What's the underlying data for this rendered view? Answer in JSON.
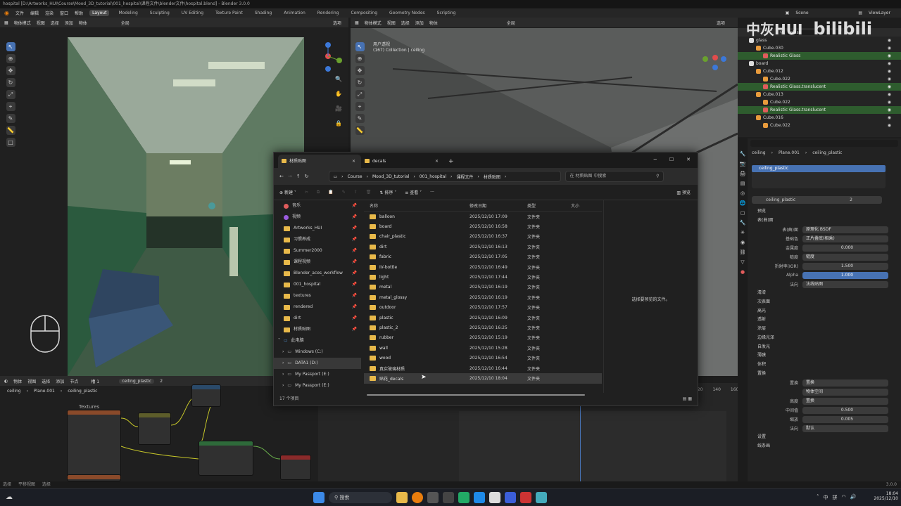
{
  "app": {
    "title": "hospital [D:\\Artworks_HUI\\Course\\Mood_3D_tutorial\\001_hospital\\课程文件\\blender文件\\hospital.blend] - Blender 3.0.0",
    "menu": [
      "文件",
      "编辑",
      "渲染",
      "窗口",
      "帮助"
    ],
    "workspaces": [
      "Layout",
      "Modeling",
      "Sculpting",
      "UV Editing",
      "Texture Paint",
      "Shading",
      "Animation",
      "Rendering",
      "Compositing",
      "Geometry Nodes",
      "Scripting"
    ],
    "active_workspace": "Layout",
    "scene": "Scene",
    "view_layer": "ViewLayer"
  },
  "viewport_left": {
    "header": [
      "物体模式",
      "视图",
      "选择",
      "添加",
      "物体"
    ],
    "shading": "全局",
    "options": "选项"
  },
  "viewport_right": {
    "header": [
      "物体模式",
      "视图",
      "选择",
      "添加",
      "物体"
    ],
    "shading": "全局",
    "options": "选项",
    "view_name": "用户透视",
    "collection": "(167) Collection | ceiling"
  },
  "watermark": {
    "text": "中灰HUI",
    "logo": "bilibili"
  },
  "outliner": {
    "search": "glass",
    "rows": [
      {
        "indent": 1,
        "label": "glass",
        "type": "collection"
      },
      {
        "indent": 2,
        "label": "Cube.030",
        "type": "mesh"
      },
      {
        "indent": 3,
        "label": "Realistic Glass",
        "type": "material"
      },
      {
        "indent": 1,
        "label": "board",
        "type": "collection"
      },
      {
        "indent": 2,
        "label": "Cube.012",
        "type": "mesh"
      },
      {
        "indent": 3,
        "label": "Cube.022",
        "type": "mesh"
      },
      {
        "indent": 3,
        "label": "Realistic Glass.translucent",
        "type": "material"
      },
      {
        "indent": 2,
        "label": "Cube.013",
        "type": "mesh"
      },
      {
        "indent": 3,
        "label": "Cube.022",
        "type": "mesh"
      },
      {
        "indent": 3,
        "label": "Realistic Glass.translucent",
        "type": "material"
      },
      {
        "indent": 2,
        "label": "Cube.016",
        "type": "mesh"
      },
      {
        "indent": 3,
        "label": "Cube.022",
        "type": "mesh"
      }
    ]
  },
  "properties": {
    "breadcrumb": [
      "ceiling",
      "Plane.001",
      "ceiling_plastic"
    ],
    "slot": "ceiling_plastic",
    "material_name": "ceiling_plastic",
    "users": "2",
    "section_preview": "预览",
    "section_surface": "表(曲)面",
    "rows": [
      {
        "label": "表(曲)面",
        "value": "原理化 BSDF",
        "style": "normal"
      },
      {
        "label": "基础色",
        "value": "正片叠底(相乘)",
        "style": "normal"
      },
      {
        "label": "金属度",
        "value": "0.000",
        "style": "center"
      },
      {
        "label": "糙度",
        "value": "糙度",
        "style": "normal"
      },
      {
        "label": "折射率(IOR)",
        "value": "1.500",
        "style": "center"
      },
      {
        "label": "Alpha",
        "value": "1.000",
        "style": "blue"
      },
      {
        "label": "法向",
        "value": "法线贴图",
        "style": "normal"
      }
    ],
    "subsections": [
      "清漆",
      "次表面",
      "高光",
      "透射",
      "涂层",
      "边缘光泽",
      "自发光",
      "薄膜"
    ],
    "volume": "体积",
    "displacement": "置换",
    "disp_rows": [
      {
        "label": "置换",
        "value": "置换",
        "style": "normal"
      },
      {
        "label": "",
        "value": "物体空间",
        "style": "normal"
      },
      {
        "label": "高度",
        "value": "置换",
        "style": "normal"
      },
      {
        "label": "中间值",
        "value": "0.500",
        "style": "center"
      },
      {
        "label": "缩放",
        "value": "0.005",
        "style": "center"
      },
      {
        "label": "法向",
        "value": "默认",
        "style": "normal"
      }
    ],
    "settings": "设置",
    "line_art": "线条画"
  },
  "node_editor": {
    "header": [
      "物体",
      "视图",
      "选择",
      "添加",
      "节点"
    ],
    "slot": "槽 1",
    "material": "ceiling_plastic",
    "users": "2",
    "breadcrumb": [
      "ceiling",
      "Plane.001",
      "ceiling_plastic"
    ],
    "frame_label": "Textures"
  },
  "timeline": {
    "frames": [
      "120",
      "140",
      "160"
    ]
  },
  "statusbar": {
    "left": [
      "选择",
      "平移视图",
      "选择"
    ],
    "version": "3.0.0"
  },
  "explorer": {
    "tabs": [
      {
        "label": "材质贴图"
      },
      {
        "label": "decals"
      }
    ],
    "breadcrumbs": [
      "Course",
      "Mood_3D_tutorial",
      "001_hospital",
      "课程文件",
      "材质贴图"
    ],
    "search_placeholder": "在 材质贴图 中搜索",
    "new_label": "新建",
    "sort_label": "排序",
    "view_label": "查看",
    "preview_label": "预览",
    "nav_items": [
      {
        "label": "音乐",
        "icon": "music",
        "pinned": true
      },
      {
        "label": "视频",
        "icon": "video",
        "pinned": true
      },
      {
        "label": "Artworks_HUI",
        "icon": "folder",
        "pinned": true
      },
      {
        "label": "习惯养成",
        "icon": "folder",
        "pinned": true
      },
      {
        "label": "Summer2000",
        "icon": "folder",
        "pinned": true
      },
      {
        "label": "课程视频",
        "icon": "folder",
        "pinned": true
      },
      {
        "label": "Blender_aces_workflow",
        "icon": "folder",
        "pinned": true
      },
      {
        "label": "001_hospital",
        "icon": "folder",
        "pinned": true
      },
      {
        "label": "textures",
        "icon": "folder",
        "pinned": true
      },
      {
        "label": "rendered",
        "icon": "folder",
        "pinned": true
      },
      {
        "label": "dirt",
        "icon": "folder",
        "pinned": true
      },
      {
        "label": "材质贴图",
        "icon": "folder",
        "pinned": true
      }
    ],
    "this_pc": "此电脑",
    "drives": [
      {
        "label": "Windows (C:)",
        "selected": false
      },
      {
        "label": "DATA1 (D:)",
        "selected": true
      },
      {
        "label": "My Passport (E:)",
        "selected": false
      },
      {
        "label": "My Passport (E:)",
        "selected": false
      }
    ],
    "columns": [
      "名称",
      "修改日期",
      "类型",
      "大小"
    ],
    "files": [
      {
        "name": "balloon",
        "date": "2025/12/10 17:09",
        "type": "文件夹"
      },
      {
        "name": "board",
        "date": "2025/12/10 16:58",
        "type": "文件夹"
      },
      {
        "name": "chair_plastic",
        "date": "2025/12/10 16:37",
        "type": "文件夹"
      },
      {
        "name": "dirt",
        "date": "2025/12/10 16:13",
        "type": "文件夹"
      },
      {
        "name": "fabric",
        "date": "2025/12/10 17:05",
        "type": "文件夹"
      },
      {
        "name": "IV-bottle",
        "date": "2025/12/10 16:49",
        "type": "文件夹"
      },
      {
        "name": "light",
        "date": "2025/12/10 17:44",
        "type": "文件夹"
      },
      {
        "name": "metal",
        "date": "2025/12/10 16:19",
        "type": "文件夹"
      },
      {
        "name": "metal_glossy",
        "date": "2025/12/10 16:19",
        "type": "文件夹"
      },
      {
        "name": "outdoor",
        "date": "2025/12/10 17:57",
        "type": "文件夹"
      },
      {
        "name": "plastic",
        "date": "2025/12/10 16:09",
        "type": "文件夹"
      },
      {
        "name": "plastic_2",
        "date": "2025/12/10 16:25",
        "type": "文件夹"
      },
      {
        "name": "rubber",
        "date": "2025/12/10 15:19",
        "type": "文件夹"
      },
      {
        "name": "wall",
        "date": "2025/12/10 15:28",
        "type": "文件夹"
      },
      {
        "name": "wood",
        "date": "2025/12/10 16:54",
        "type": "文件夹"
      },
      {
        "name": "真实玻璃材质",
        "date": "2025/12/10 16:44",
        "type": "文件夹"
      },
      {
        "name": "贴花_decals",
        "date": "2025/12/10 18:04",
        "type": "文件夹",
        "selected": true
      }
    ],
    "preview_message": "选择要预览的文件。",
    "item_count": "17 个项目"
  },
  "taskbar": {
    "search": "搜索",
    "tray": [
      "中",
      "拼"
    ],
    "time": "18:04",
    "date": "2025/12/10"
  },
  "colors": {
    "accent": "#4772b3",
    "folder": "#e8b94a",
    "material_row": "#2e5c2e",
    "blender_bg": "#1d1d1d",
    "explorer_bg": "#202020"
  }
}
